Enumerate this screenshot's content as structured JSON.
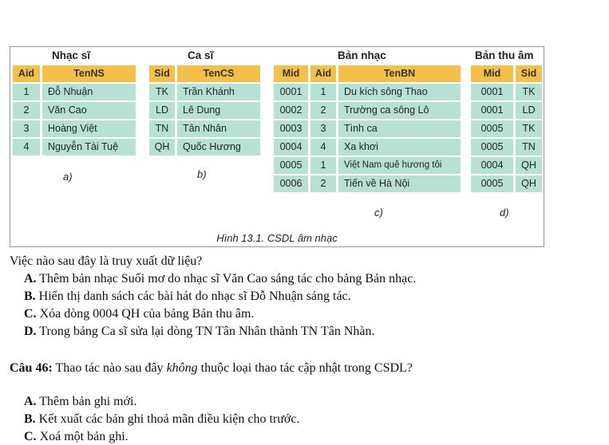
{
  "figure": {
    "tables": {
      "nhac_si": {
        "title": "Nhạc sĩ",
        "headers": [
          "Aid",
          "TenNS"
        ],
        "rows": [
          [
            "1",
            "Đỗ Nhuận"
          ],
          [
            "2",
            "Văn Cao"
          ],
          [
            "3",
            "Hoàng Việt"
          ],
          [
            "4",
            "Nguyễn Tài Tuệ"
          ]
        ],
        "label": "a)"
      },
      "ca_si": {
        "title": "Ca sĩ",
        "headers": [
          "Sid",
          "TenCS"
        ],
        "rows": [
          [
            "TK",
            "Trần Khánh"
          ],
          [
            "LD",
            "Lê Dung"
          ],
          [
            "TN",
            "Tân Nhân"
          ],
          [
            "QH",
            "Quốc Hương"
          ]
        ],
        "label": "b)"
      },
      "ban_nhac": {
        "title": "Bản nhạc",
        "headers": [
          "Mid",
          "Aid",
          "TenBN"
        ],
        "rows": [
          [
            "0001",
            "1",
            "Du kích sông Thao"
          ],
          [
            "0002",
            "2",
            "Trường ca sông Lô"
          ],
          [
            "0003",
            "3",
            "Tình ca"
          ],
          [
            "0004",
            "4",
            "Xa khơi"
          ],
          [
            "0005",
            "1",
            "Việt Nam quê hương tôi"
          ],
          [
            "0006",
            "2",
            "Tiến về Hà Nội"
          ]
        ],
        "label": "c)"
      },
      "ban_thu_am": {
        "title": "Bản thu âm",
        "headers": [
          "Mid",
          "Sid"
        ],
        "rows": [
          [
            "0001",
            "TK"
          ],
          [
            "0001",
            "LD"
          ],
          [
            "0005",
            "TK"
          ],
          [
            "0005",
            "TN"
          ],
          [
            "0004",
            "QH"
          ],
          [
            "0005",
            "QH"
          ]
        ],
        "label": "d)"
      }
    },
    "caption": "Hình 13.1. CSDL âm nhạc"
  },
  "question45": {
    "prompt": "Việc nào sau đây là truy xuất dữ liệu?",
    "options": [
      {
        "label": "A.",
        "text": "Thêm bản nhạc Suối mơ do nhạc sĩ Văn Cao sáng tác cho bảng Bản nhạc."
      },
      {
        "label": "B.",
        "text": "Hiển thị danh sách các bài hát do nhạc sĩ Đỗ Nhuận sáng tác."
      },
      {
        "label": "C.",
        "text": "Xóa dòng 0004 QH của bảng Bản thu âm."
      },
      {
        "label": "D.",
        "text": "Trong bảng Ca sĩ sửa lại dòng TN Tân Nhân thành TN Tân Nhàn."
      }
    ]
  },
  "question46": {
    "number": "Câu 46:",
    "prompt_before": "Thao tác nào sau đây ",
    "prompt_emphasis": "không",
    "prompt_after": " thuộc loại thao tác cập nhật trong CSDL?",
    "options": [
      {
        "label": "A.",
        "text": "Thêm bản ghi mới."
      },
      {
        "label": "B.",
        "text": "Kết xuất các bản ghi thoả mãn điều kiện cho trước."
      },
      {
        "label": "C.",
        "text": "Xoá một bản ghi."
      }
    ]
  }
}
